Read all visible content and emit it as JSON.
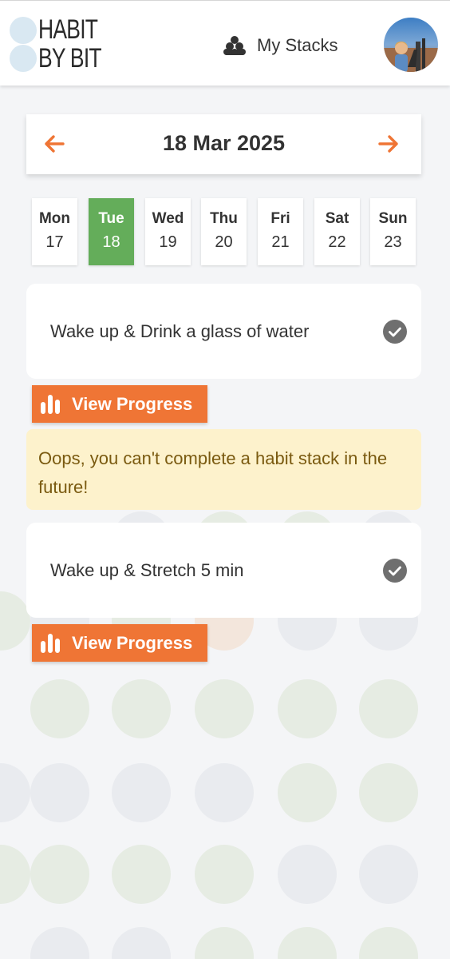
{
  "header": {
    "logo_line1": "HABIT",
    "logo_line2": "BY BIT",
    "nav_stacks_label": "My Stacks",
    "nav_stacks_icon": "stack-icon",
    "avatar_icon": "user-avatar"
  },
  "date_nav": {
    "current_date": "18 Mar 2025",
    "prev_icon": "arrow-left-icon",
    "next_icon": "arrow-right-icon",
    "accent_color": "#ef7535"
  },
  "days": [
    {
      "name": "Mon",
      "date": "17",
      "active": false
    },
    {
      "name": "Tue",
      "date": "18",
      "active": true
    },
    {
      "name": "Wed",
      "date": "19",
      "active": false
    },
    {
      "name": "Thu",
      "date": "20",
      "active": false
    },
    {
      "name": "Fri",
      "date": "21",
      "active": false
    },
    {
      "name": "Sat",
      "date": "22",
      "active": false
    },
    {
      "name": "Sun",
      "date": "23",
      "active": false
    }
  ],
  "active_day_color": "#64ad5a",
  "stacks": [
    {
      "title": "Wake up & Drink a glass of water",
      "button_label": "View Progress",
      "check_icon": "check-circle-icon",
      "bar_icon": "bar-chart-icon"
    },
    {
      "title": "Wake up & Stretch 5 min",
      "button_label": "View Progress",
      "check_icon": "check-circle-icon",
      "bar_icon": "bar-chart-icon"
    }
  ],
  "alert": {
    "message": "Oops, you can't complete a habit stack in the future!",
    "bg_color": "#fdf2cc"
  }
}
